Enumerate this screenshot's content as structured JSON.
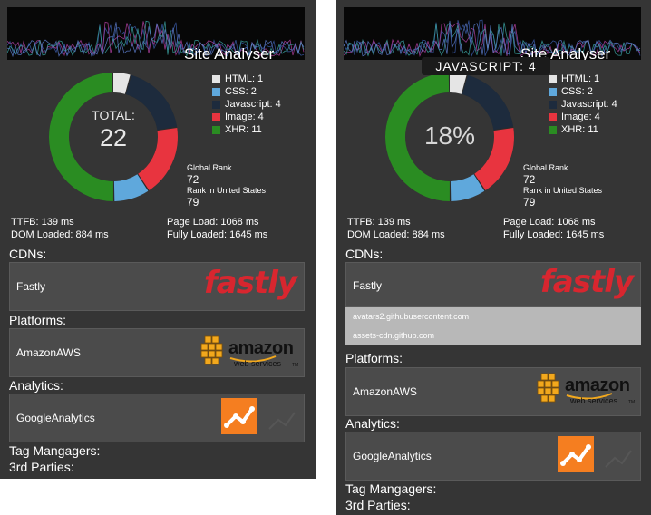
{
  "app_title": "Site Analyser",
  "colors": {
    "html": "#e5e5e5",
    "css": "#5fa8dc",
    "javascript": "#1d2b3d",
    "image": "#e8343f",
    "xhr": "#2a8c22",
    "panel_bg": "#353535"
  },
  "legend": [
    {
      "label": "HTML: 1",
      "value": 1,
      "color": "#e5e5e5"
    },
    {
      "label": "CSS: 2",
      "value": 2,
      "color": "#5fa8dc"
    },
    {
      "label": "Javascript: 4",
      "value": 4,
      "color": "#1d2b3d"
    },
    {
      "label": "Image: 4",
      "value": 4,
      "color": "#e8343f"
    },
    {
      "label": "XHR: 11",
      "value": 11,
      "color": "#2a8c22"
    }
  ],
  "left": {
    "total_label": "TOTAL:",
    "total_value": "22"
  },
  "right": {
    "percent_value": "18%",
    "tooltip": "JAVASCRIPT: 4"
  },
  "rank": {
    "global_label": "Global Rank",
    "global_value": "72",
    "country_label": "Rank in United States",
    "country_value": "79"
  },
  "metrics": {
    "ttfb": "TTFB: 139 ms",
    "dom": "DOM Loaded: 884 ms",
    "page_load": "Page Load: 1068 ms",
    "fully_loaded": "Fully Loaded: 1645 ms"
  },
  "sections": {
    "cdns": "CDNs:",
    "platforms": "Platforms:",
    "analytics": "Analytics:",
    "tag_managers": "Tag Mangagers:",
    "third_parties": "3rd Parties:"
  },
  "cdn": {
    "name": "Fastly",
    "logo_text": "fastly",
    "hosts": [
      "avatars2.githubusercontent.com",
      "assets-cdn.github.com"
    ]
  },
  "platform": {
    "name": "AmazonAWS",
    "logo_text": "amazon",
    "logo_subtext": "web services",
    "logo_tm": "TM"
  },
  "analytics": {
    "name": "GoogleAnalytics"
  }
}
